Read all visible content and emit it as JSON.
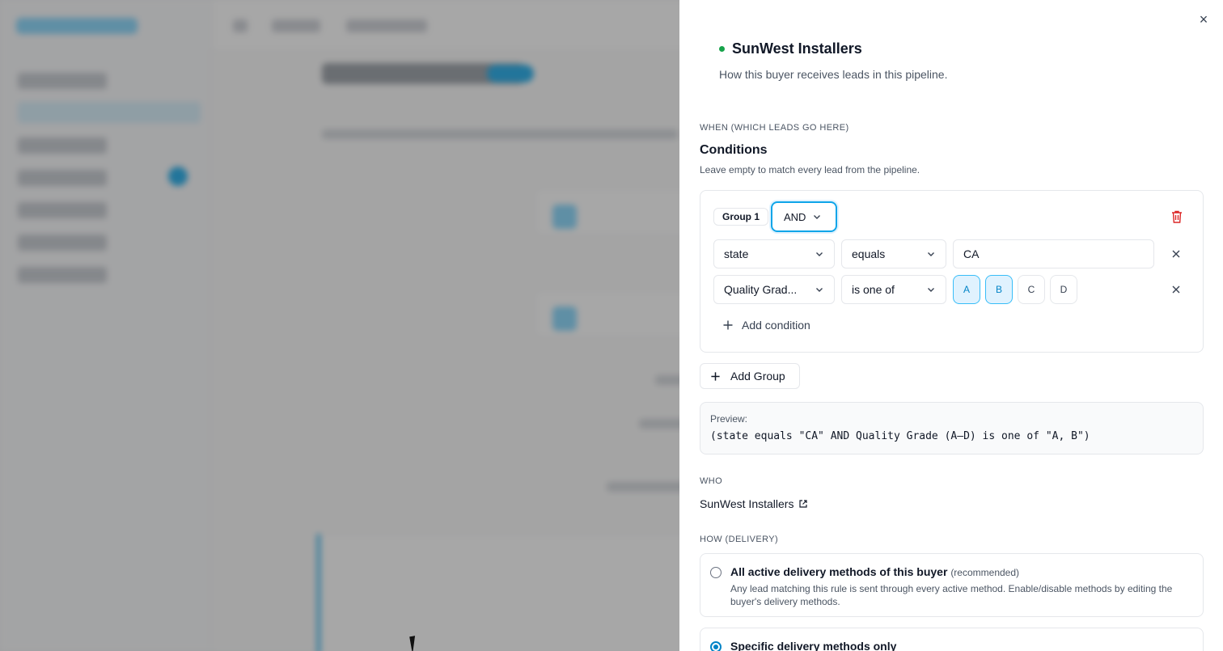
{
  "drawer": {
    "title": "SunWest Installers",
    "subtitle": "How this buyer receives leads in this pipeline.",
    "close_label": "×",
    "status_color": "#16a34a"
  },
  "when": {
    "section_label": "WHEN (WHICH LEADS GO HERE)",
    "heading": "Conditions",
    "help": "Leave empty to match every lead from the pipeline."
  },
  "group": {
    "label": "Group 1",
    "operator": "AND",
    "conditions": [
      {
        "field": "state",
        "op": "equals",
        "value": "CA"
      },
      {
        "field": "Quality Grad...",
        "op": "is one of",
        "options": [
          "A",
          "B",
          "C",
          "D"
        ],
        "selected": [
          "A",
          "B"
        ]
      }
    ],
    "add_condition_label": "Add condition"
  },
  "add_group_label": "Add Group",
  "preview": {
    "label": "Preview:",
    "text": "(state equals \"CA\" AND Quality Grade (A–D) is one of \"A, B\")"
  },
  "who": {
    "section_label": "WHO",
    "buyer": "SunWest Installers"
  },
  "how": {
    "section_label": "HOW (DELIVERY)",
    "options": [
      {
        "title": "All active delivery methods of this buyer",
        "note": "(recommended)",
        "description": "Any lead matching this rule is sent through every active method. Enable/disable methods by editing the buyer's delivery methods.",
        "checked": false
      },
      {
        "title": "Specific delivery methods only",
        "checked": true
      }
    ]
  },
  "colors": {
    "accent": "#0ea5e9",
    "danger": "#dc2626"
  }
}
